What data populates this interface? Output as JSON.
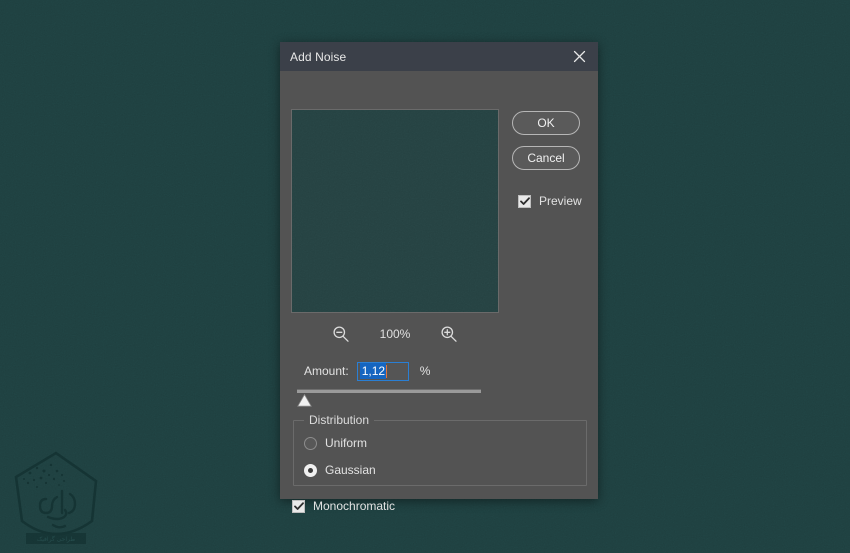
{
  "desktop": {
    "background_color": "#1e3f3f",
    "watermark_name": "site-watermark-logo",
    "watermark_caption": "طراحی گرافیک"
  },
  "dialog": {
    "title": "Add Noise",
    "close_icon": "close-icon",
    "titlebar_color": "#3b4049",
    "body_color": "#535353",
    "preview": {
      "icon_name": "noise-preview-image",
      "color": "#254141"
    },
    "zoom": {
      "zoom_out_icon": "zoom-out-magnifier-icon",
      "zoom_in_icon": "zoom-in-magnifier-icon",
      "level": "100%"
    },
    "amount": {
      "label": "Amount:",
      "value": "1,12",
      "placeholder": "0",
      "unit": "%",
      "selection_color": "#1565c0",
      "focus_border_color": "#2a7fd4"
    },
    "slider": {
      "name": "amount-slider",
      "value": 1.12,
      "min": 0,
      "max": 400
    },
    "distribution": {
      "legend": "Distribution",
      "selected": "Gaussian",
      "options": [
        {
          "label": "Uniform",
          "selected": false
        },
        {
          "label": "Gaussian",
          "selected": true
        }
      ]
    },
    "monochromatic": {
      "label": "Monochromatic",
      "checked": true
    },
    "buttons": {
      "ok_label": "OK",
      "cancel_label": "Cancel"
    },
    "preview_toggle": {
      "label": "Preview",
      "checked": true
    }
  }
}
